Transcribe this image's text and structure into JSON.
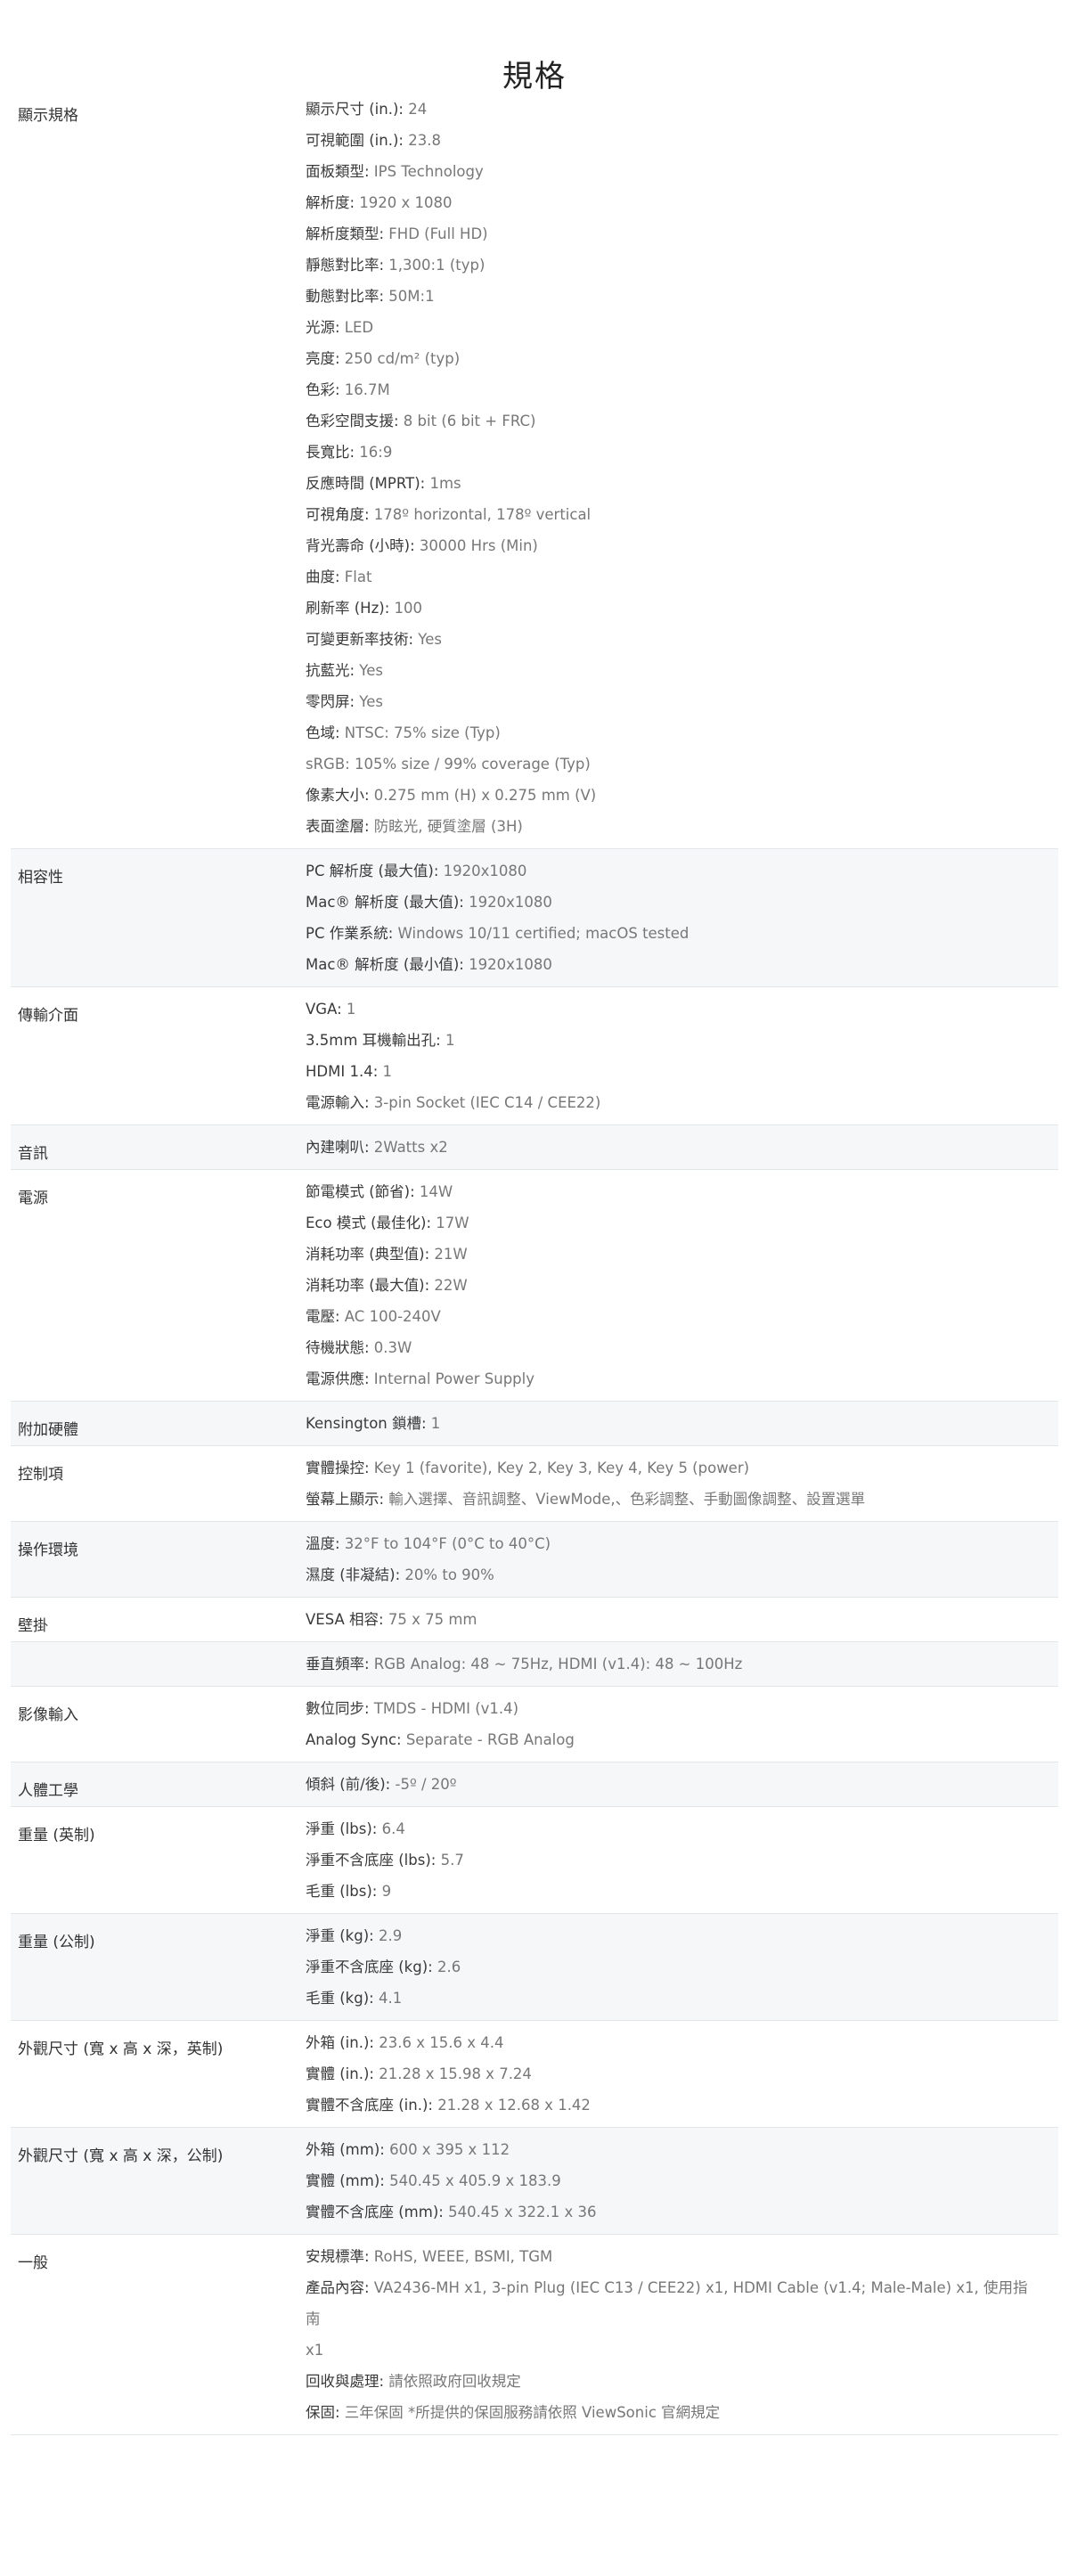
{
  "page_title": "規格",
  "rows": [
    {
      "label": "顯示規格",
      "items": [
        {
          "k": "顯示尺寸 (in.):",
          "v": " 24"
        },
        {
          "k": "可視範圍 (in.):",
          "v": " 23.8"
        },
        {
          "k": "面板類型:",
          "v": " IPS Technology"
        },
        {
          "k": "解析度:",
          "v": " 1920 x 1080"
        },
        {
          "k": "解析度類型:",
          "v": " FHD (Full HD)"
        },
        {
          "k": "靜態對比率:",
          "v": " 1,300:1 (typ)"
        },
        {
          "k": "動態對比率:",
          "v": " 50M:1"
        },
        {
          "k": "光源:",
          "v": " LED"
        },
        {
          "k": "亮度:",
          "v": " 250 cd/m² (typ)"
        },
        {
          "k": "色彩:",
          "v": " 16.7M"
        },
        {
          "k": "色彩空間支援:",
          "v": " 8 bit (6 bit + FRC)"
        },
        {
          "k": "長寬比:",
          "v": " 16:9"
        },
        {
          "k": "反應時間 (MPRT):",
          "v": " 1ms"
        },
        {
          "k": "可視角度:",
          "v": " 178º horizontal, 178º vertical"
        },
        {
          "k": "背光壽命 (小時):",
          "v": " 30000 Hrs (Min)"
        },
        {
          "k": "曲度:",
          "v": " Flat"
        },
        {
          "k": "刷新率 (Hz):",
          "v": " 100"
        },
        {
          "k": "可變更新率技術:",
          "v": " Yes"
        },
        {
          "k": "抗藍光:",
          "v": " Yes"
        },
        {
          "k": "零閃屏:",
          "v": " Yes"
        },
        {
          "k": "色域:",
          "v": " NTSC: 75% size (Typ)"
        },
        {
          "k": "",
          "v": "sRGB: 105% size / 99% coverage (Typ)"
        },
        {
          "k": "像素大小:",
          "v": " 0.275 mm (H) x 0.275 mm (V)"
        },
        {
          "k": "表面塗層:",
          "v": " 防眩光, 硬質塗層 (3H)"
        }
      ]
    },
    {
      "label": "相容性",
      "items": [
        {
          "k": "PC 解析度 (最大值):",
          "v": " 1920x1080"
        },
        {
          "k": "Mac® 解析度 (最大值):",
          "v": " 1920x1080"
        },
        {
          "k": "PC 作業系統:",
          "v": " Windows 10/11 certified; macOS tested"
        },
        {
          "k": "Mac® 解析度 (最小值):",
          "v": " 1920x1080"
        }
      ]
    },
    {
      "label": "傳輸介面",
      "items": [
        {
          "k": "VGA:",
          "v": " 1"
        },
        {
          "k": "3.5mm 耳機輸出孔:",
          "v": " 1"
        },
        {
          "k": "HDMI 1.4:",
          "v": " 1"
        },
        {
          "k": "電源輸入:",
          "v": " 3-pin Socket (IEC C14 / CEE22)"
        }
      ]
    },
    {
      "label": "音訊",
      "items": [
        {
          "k": "內建喇叭:",
          "v": " 2Watts x2"
        }
      ]
    },
    {
      "label": "電源",
      "items": [
        {
          "k": "節電模式 (節省):",
          "v": " 14W"
        },
        {
          "k": "Eco 模式 (最佳化):",
          "v": " 17W"
        },
        {
          "k": "消耗功率 (典型值):",
          "v": " 21W"
        },
        {
          "k": "消耗功率 (最大值):",
          "v": " 22W"
        },
        {
          "k": "電壓:",
          "v": " AC 100-240V"
        },
        {
          "k": "待機狀態:",
          "v": " 0.3W"
        },
        {
          "k": "電源供應:",
          "v": " Internal Power Supply"
        }
      ]
    },
    {
      "label": "附加硬體",
      "items": [
        {
          "k": "Kensington 鎖槽:",
          "v": " 1"
        }
      ]
    },
    {
      "label": "控制項",
      "items": [
        {
          "k": "實體操控:",
          "v": " Key 1 (favorite), Key 2, Key 3, Key 4, Key 5 (power)"
        },
        {
          "k": "螢幕上顯示:",
          "v": " 輸入選擇、音訊調整、ViewMode,、色彩調整、手動圖像調整、設置選單"
        }
      ]
    },
    {
      "label": "操作環境",
      "items": [
        {
          "k": "溫度:",
          "v": " 32°F to 104°F (0°C to 40°C)"
        },
        {
          "k": "濕度 (非凝結):",
          "v": " 20% to 90%"
        }
      ]
    },
    {
      "label": "壁掛",
      "items": [
        {
          "k": "VESA 相容:",
          "v": " 75 x 75 mm"
        }
      ]
    },
    {
      "label": "",
      "items": [
        {
          "k": "垂直頻率:",
          "v": " RGB Analog: 48 ~ 75Hz, HDMI (v1.4): 48 ~ 100Hz"
        }
      ]
    },
    {
      "label": "影像輸入",
      "items": [
        {
          "k": "數位同步:",
          "v": " TMDS - HDMI (v1.4)"
        },
        {
          "k": "Analog Sync:",
          "v": " Separate - RGB Analog"
        }
      ]
    },
    {
      "label": "人體工學",
      "items": [
        {
          "k": "傾斜 (前/後):",
          "v": " -5º / 20º"
        }
      ]
    },
    {
      "label": "重量 (英制)",
      "items": [
        {
          "k": "淨重 (lbs):",
          "v": " 6.4"
        },
        {
          "k": "淨重不含底座 (lbs):",
          "v": " 5.7"
        },
        {
          "k": "毛重 (lbs):",
          "v": " 9"
        }
      ]
    },
    {
      "label": "重量 (公制)",
      "items": [
        {
          "k": "淨重 (kg):",
          "v": " 2.9"
        },
        {
          "k": "淨重不含底座 (kg):",
          "v": " 2.6"
        },
        {
          "k": "毛重 (kg):",
          "v": " 4.1"
        }
      ]
    },
    {
      "label": "外觀尺寸 (寬 x 高 x 深，英制)",
      "items": [
        {
          "k": "外箱 (in.):",
          "v": " 23.6 x 15.6 x 4.4"
        },
        {
          "k": "實體 (in.):",
          "v": " 21.28 x 15.98 x 7.24"
        },
        {
          "k": "實體不含底座 (in.):",
          "v": " 21.28 x 12.68 x 1.42"
        }
      ]
    },
    {
      "label": "外觀尺寸 (寬 x 高 x 深，公制)",
      "items": [
        {
          "k": "外箱 (mm):",
          "v": " 600 x 395 x 112"
        },
        {
          "k": "實體 (mm):",
          "v": " 540.45 x 405.9 x 183.9"
        },
        {
          "k": "實體不含底座 (mm):",
          "v": " 540.45 x 322.1 x 36"
        }
      ]
    },
    {
      "label": "一般",
      "items": [
        {
          "k": "安規標準:",
          "v": " RoHS, WEEE, BSMI, TGM"
        },
        {
          "k": "產品內容:",
          "v": " VA2436-MH x1, 3-pin Plug (IEC C13 / CEE22) x1, HDMI Cable (v1.4; Male-Male) x1, 使用指南"
        },
        {
          "k": "",
          "v": "x1"
        },
        {
          "k": "回收與處理:",
          "v": " 請依照政府回收規定"
        },
        {
          "k": "保固:",
          "v": " 三年保固 *所提供的保固服務請依照 ViewSonic 官網規定"
        }
      ]
    }
  ]
}
